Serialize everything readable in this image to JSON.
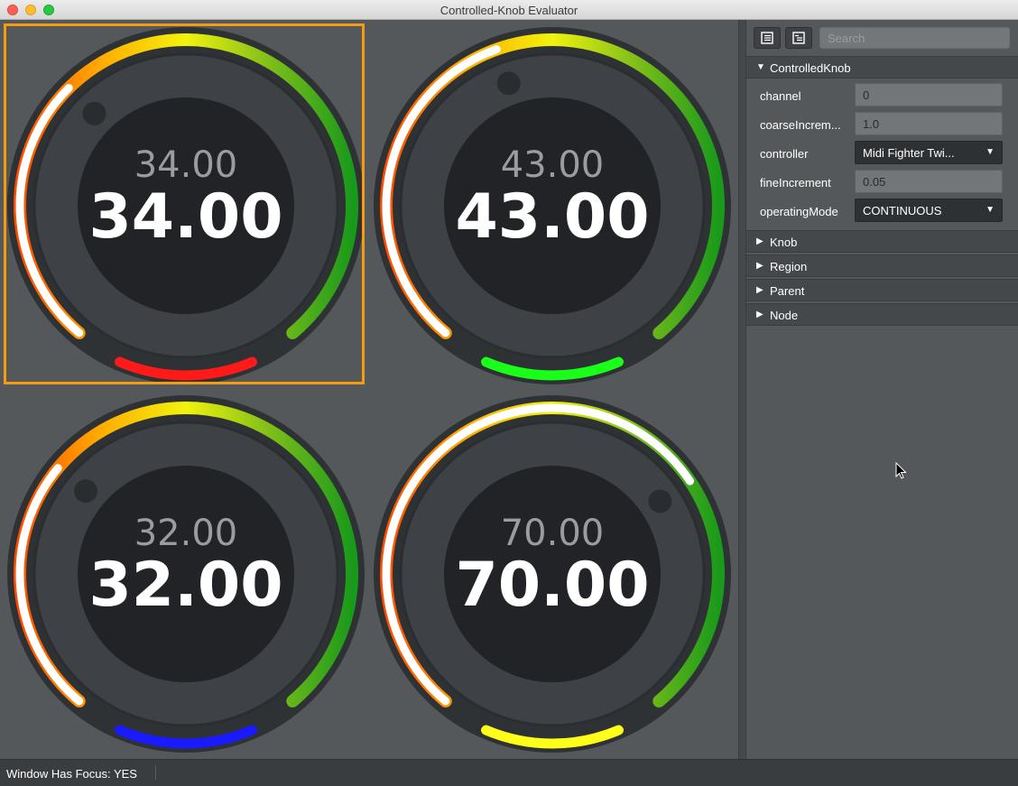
{
  "window": {
    "title": "Controlled-Knob Evaluator"
  },
  "knobs": [
    {
      "small": "34.00",
      "big": "34.00",
      "value": 34,
      "range": [
        0,
        100
      ],
      "indicator_color": "#ff1a1a",
      "focused": true
    },
    {
      "small": "43.00",
      "big": "43.00",
      "value": 43,
      "range": [
        0,
        100
      ],
      "indicator_color": "#1aff1a",
      "focused": false
    },
    {
      "small": "32.00",
      "big": "32.00",
      "value": 32,
      "range": [
        0,
        100
      ],
      "indicator_color": "#1a1aff",
      "focused": false
    },
    {
      "small": "70.00",
      "big": "70.00",
      "value": 70,
      "range": [
        0,
        100
      ],
      "indicator_color": "#ffff1a",
      "focused": false
    }
  ],
  "panel": {
    "search_placeholder": "Search",
    "toolbar": {
      "icons": [
        "list-view-icon",
        "detail-view-icon"
      ]
    },
    "section_expanded": "ControlledKnob",
    "props": [
      {
        "label": "channel",
        "value": "0",
        "kind": "field"
      },
      {
        "label": "coarseIncrem...",
        "value": "1.0",
        "kind": "field"
      },
      {
        "label": "controller",
        "value": "Midi Fighter Twi...",
        "kind": "combo"
      },
      {
        "label": "fineIncrement",
        "value": "0.05",
        "kind": "field"
      },
      {
        "label": "operatingMode",
        "value": "CONTINUOUS",
        "kind": "combo"
      }
    ],
    "collapsed_sections": [
      "Knob",
      "Region",
      "Parent",
      "Node"
    ]
  },
  "status": {
    "text": "Window Has Focus:  YES"
  },
  "colors": {
    "focus_border": "#f39c12",
    "gradient": [
      "#ff4d00",
      "#ffae00",
      "#f2f20d",
      "#7fbf1a",
      "#1a9a1a"
    ]
  }
}
